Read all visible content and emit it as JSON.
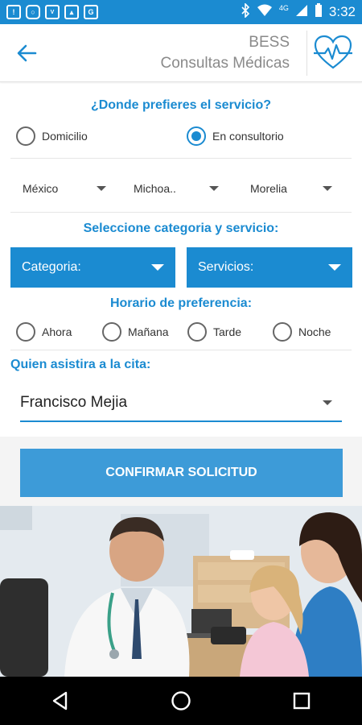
{
  "status_bar": {
    "time": "3:32",
    "network": "4G",
    "left_icons": [
      "notification-icon",
      "instagram-icon",
      "voice-app-icon",
      "image-icon",
      "translate-icon"
    ],
    "right_icons": [
      "bluetooth-icon",
      "wifi-icon",
      "signal-icon",
      "battery-icon"
    ]
  },
  "header": {
    "title_line1": "BESS",
    "title_line2": "Consultas Médicas",
    "logo_icon": "heart-pulse-icon"
  },
  "service_location": {
    "question": "¿Donde prefieres el servicio?",
    "options": [
      {
        "label": "Domicilio",
        "selected": false
      },
      {
        "label": "En consultorio",
        "selected": true
      }
    ]
  },
  "location": {
    "country": "México",
    "state": "Michoa..",
    "city": "Morelia"
  },
  "category_section": {
    "title": "Seleccione categoria y servicio:",
    "category_label": "Categoria:",
    "services_label": "Servicios:"
  },
  "schedule": {
    "title": "Horario de preferencia:",
    "options": [
      {
        "label": "Ahora",
        "selected": false
      },
      {
        "label": "Mañana",
        "selected": false
      },
      {
        "label": "Tarde",
        "selected": false
      },
      {
        "label": "Noche",
        "selected": false
      }
    ]
  },
  "attendee": {
    "label": "Quien asistira a la cita:",
    "value": "Francisco Mejia"
  },
  "confirm_label": "CONFIRMAR SOLICITUD",
  "colors": {
    "primary": "#1b8bd1",
    "button": "#3d9bd8"
  }
}
